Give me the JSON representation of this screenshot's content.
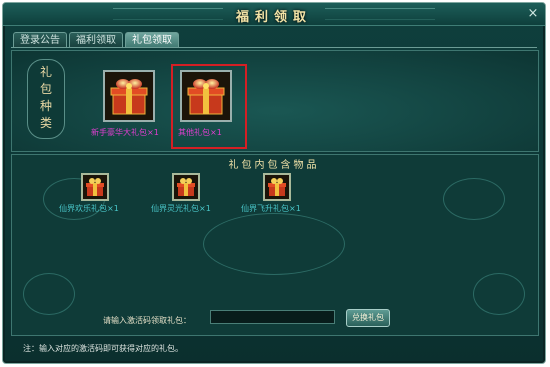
{
  "window": {
    "title": "福利领取",
    "close_glyph": "×"
  },
  "tabs": [
    {
      "label": "登录公告",
      "active": false
    },
    {
      "label": "福利领取",
      "active": false
    },
    {
      "label": "礼包领取",
      "active": true
    }
  ],
  "gift_types": {
    "label": "礼包种类",
    "items": [
      {
        "name": "新手豪华大礼包×1",
        "color": "#e03fd0",
        "selected": false
      },
      {
        "name": "其他礼包×1",
        "color": "#e03fd0",
        "selected": true
      }
    ]
  },
  "contents": {
    "title": "礼包内包含物品",
    "items": [
      {
        "name": "仙界欢乐礼包×1"
      },
      {
        "name": "仙界灵光礼包×1"
      },
      {
        "name": "仙界飞升礼包×1"
      }
    ]
  },
  "redeem": {
    "prompt": "请输入激活码领取礼包：",
    "input_value": "",
    "button_label": "兑换礼包"
  },
  "note": "注：输入对应的激活码即可获得对应的礼包。",
  "colors": {
    "accent_gold": "#f3e3a6",
    "item_cyan": "#49c6c9",
    "gift_name_magenta": "#e03fd0",
    "selection_red": "#d41f24"
  }
}
